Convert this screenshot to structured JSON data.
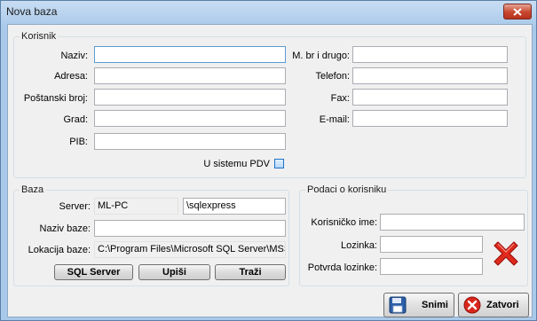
{
  "window": {
    "title": "Nova baza"
  },
  "korisnik": {
    "legend": "Korisnik",
    "naziv_label": "Naziv:",
    "adresa_label": "Adresa:",
    "postanski_label": "Poštanski broj:",
    "grad_label": "Grad:",
    "pib_label": "PIB:",
    "mbr_label": "M. br i drugo:",
    "telefon_label": "Telefon:",
    "fax_label": "Fax:",
    "email_label": "E-mail:",
    "pdv_label": "U sistemu PDV",
    "naziv_value": "",
    "adresa_value": "",
    "postanski_value": "",
    "grad_value": "",
    "pib_value": "",
    "mbr_value": "",
    "telefon_value": "",
    "fax_value": "",
    "email_value": "",
    "pdv_checked": false
  },
  "baza": {
    "legend": "Baza",
    "server_label": "Server:",
    "server_value": "ML-PC",
    "instance_value": "\\sqlexpress",
    "naziv_baze_label": "Naziv baze:",
    "naziv_baze_value": "",
    "lokacija_label": "Lokacija baze:",
    "lokacija_value": "C:\\Program Files\\Microsoft SQL Server\\MSS",
    "sql_server_button": "SQL Server",
    "upisi_button": "Upiši",
    "trazi_button": "Traži"
  },
  "podaci": {
    "legend": "Podaci o korisniku",
    "korisnicko_label": "Korisničko ime:",
    "lozinka_label": "Lozinka:",
    "potvrda_label": "Potvrda lozinke:",
    "korisnicko_value": "",
    "lozinka_value": "",
    "potvrda_value": ""
  },
  "actions": {
    "snimi_label": "Snimi",
    "zatvori_label": "Zatvori"
  }
}
